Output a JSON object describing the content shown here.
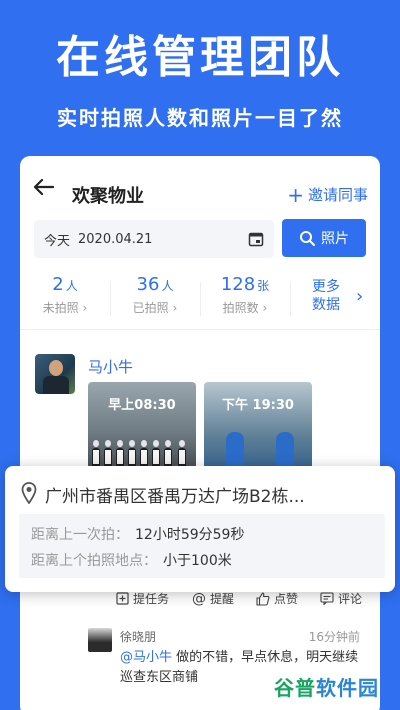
{
  "promo": {
    "title": "在线管理团队",
    "subtitle": "实时拍照人数和照片一目了然"
  },
  "header": {
    "title": "欢聚物业",
    "invite_label": "邀请同事"
  },
  "filter": {
    "date_prefix": "今天",
    "date_value": "2020.04.21",
    "photo_button": "照片"
  },
  "stats": [
    {
      "num": "2",
      "unit": "人",
      "label": "未拍照"
    },
    {
      "num": "36",
      "unit": "人",
      "label": "已拍照"
    },
    {
      "num": "128",
      "unit": "张",
      "label": "拍照数"
    }
  ],
  "more": {
    "line1": "更多",
    "line2": "数据"
  },
  "post": {
    "user_name": "马小牛",
    "photos": [
      {
        "label": "早上08:30"
      },
      {
        "label": "下午 19:30"
      }
    ]
  },
  "location": {
    "address": "广州市番禺区番禺万达广场B2栋...",
    "row1_label": "距离上一次拍：",
    "row1_value": "12小时59分59秒",
    "row2_label": "距离上个拍照地点：",
    "row2_value": "小于100米"
  },
  "actions": [
    {
      "label": "提任务",
      "icon": "task-icon"
    },
    {
      "label": "提醒",
      "icon": "at-icon"
    },
    {
      "label": "点赞",
      "icon": "thumbs-up-icon"
    },
    {
      "label": "评论",
      "icon": "comment-icon"
    }
  ],
  "comment": {
    "author": "徐晓朋",
    "time": "16分钟前",
    "mention": "@马小牛",
    "text": " 做的不错，早点休息，明天继续巡查东区商铺"
  },
  "watermark": {
    "part1": "谷普",
    "part2": "软件园"
  },
  "colors": {
    "brand_blue": "#2f6ff0",
    "background": "#2f6ff0"
  }
}
